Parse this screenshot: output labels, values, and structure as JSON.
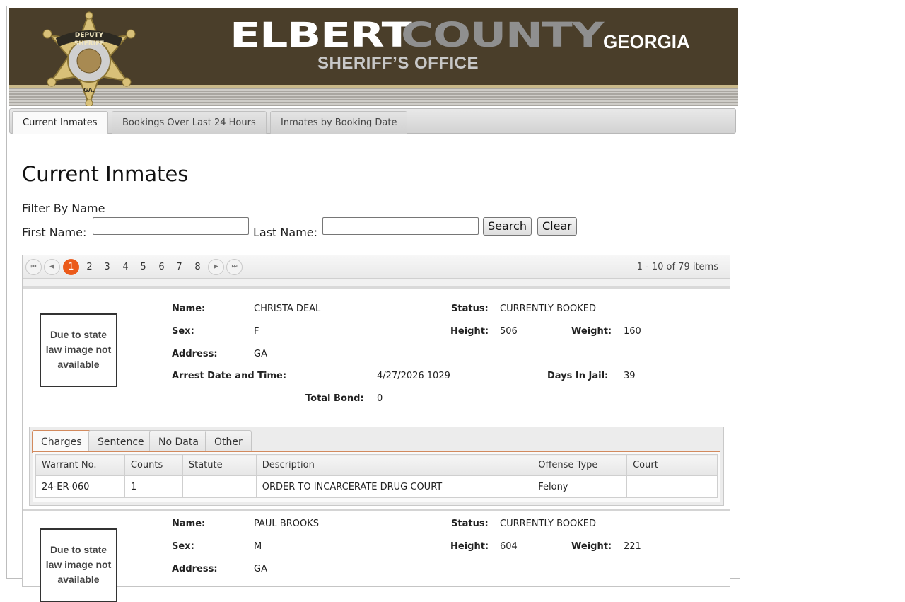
{
  "banner": {
    "name_part1": "ELBERT",
    "name_part2": "COUNTY",
    "state": "GEORGIA",
    "office": "SHERIFF’S OFFICE",
    "badge": {
      "top": "DEPUTY",
      "middle": "SHERIFF",
      "bottom": "GA.",
      "ring": "GEORGIA SHERIFFS' ASSOCIATION INC."
    }
  },
  "tabs": [
    {
      "label": "Current Inmates",
      "active": true
    },
    {
      "label": "Bookings Over Last 24 Hours",
      "active": false
    },
    {
      "label": "Inmates by Booking Date",
      "active": false
    }
  ],
  "page": {
    "title": "Current Inmates",
    "filter_title": "Filter By Name",
    "first_name_label": "First Name:",
    "first_name_value": "",
    "last_name_label": "Last Name:",
    "last_name_value": "",
    "search_label": "Search",
    "clear_label": "Clear"
  },
  "pager": {
    "first": "⏮",
    "prev": "◀",
    "next": "▶",
    "last": "⏭",
    "pages": [
      "1",
      "2",
      "3",
      "4",
      "5",
      "6",
      "7",
      "8"
    ],
    "current_page": "1",
    "info": "1 - 10 of 79 items"
  },
  "field_labels": {
    "name": "Name:",
    "sex": "Sex:",
    "address": "Address:",
    "arrest": "Arrest Date and Time:",
    "total_bond": "Total Bond:",
    "status": "Status:",
    "height": "Height:",
    "weight": "Weight:",
    "days_in_jail": "Days In Jail:"
  },
  "no_photo_text_1": "Due to state",
  "no_photo_text_2": "law image not",
  "no_photo_text_3": "available",
  "detail_tabs": [
    "Charges",
    "Sentence",
    "No Data",
    "Other"
  ],
  "charges_columns": [
    "Warrant No.",
    "Counts",
    "Statute",
    "Description",
    "Offense Type",
    "Court"
  ],
  "inmates": [
    {
      "name": "CHRISTA DEAL",
      "sex": "F",
      "address": "GA",
      "arrest": "4/27/2026 1029",
      "total_bond": "0",
      "status": "CURRENTLY BOOKED",
      "height": "506",
      "weight": "160",
      "days_in_jail": "39",
      "charges": [
        {
          "warrant": "24-ER-060",
          "counts": "1",
          "statute": "",
          "description": "ORDER TO INCARCERATE DRUG COURT",
          "offense_type": "Felony",
          "court": ""
        }
      ]
    },
    {
      "name": "PAUL BROOKS",
      "sex": "M",
      "address": "GA",
      "status": "CURRENTLY BOOKED",
      "height": "604",
      "weight": "221"
    }
  ],
  "colors": {
    "banner_bg": "#4a3e2a",
    "accent_orange": "#eb5a1a",
    "county_gray": "#8f8f8f"
  }
}
